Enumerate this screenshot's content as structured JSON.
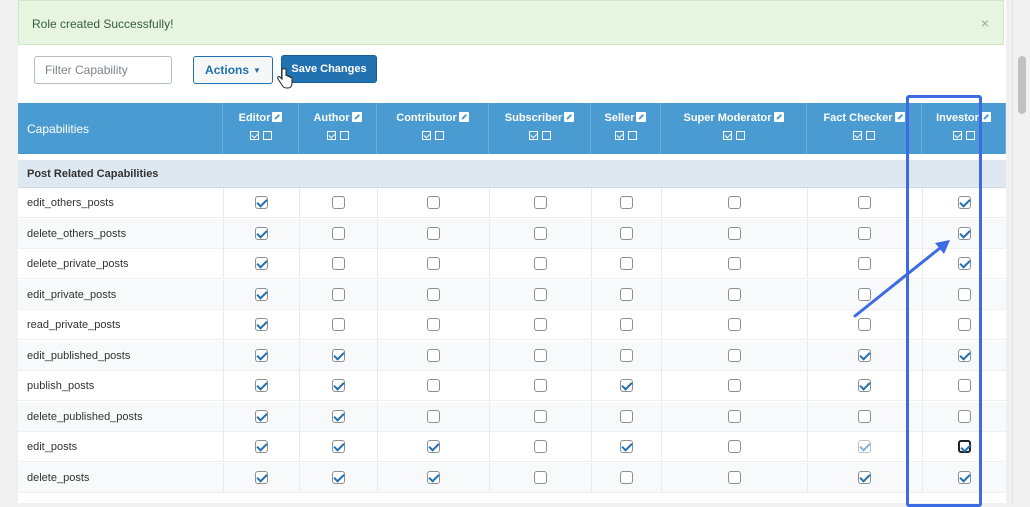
{
  "notice": {
    "message": "Role created Successfully!",
    "close_glyph": "×"
  },
  "toolbar": {
    "filter_placeholder": "Filter Capability",
    "actions_label": "Actions",
    "save_label": "Save Changes"
  },
  "table": {
    "first_header": "Capabilities",
    "roles": [
      "Editor",
      "Author",
      "Contributor",
      "Subscriber",
      "Seller",
      "Super Moderator",
      "Fact Checker",
      "Investor"
    ],
    "section": "Post Related Capabilities",
    "rows": [
      {
        "name": "edit_others_posts",
        "checks": [
          true,
          false,
          false,
          false,
          false,
          false,
          false,
          true
        ]
      },
      {
        "name": "delete_others_posts",
        "checks": [
          true,
          false,
          false,
          false,
          false,
          false,
          false,
          true
        ]
      },
      {
        "name": "delete_private_posts",
        "checks": [
          true,
          false,
          false,
          false,
          false,
          false,
          false,
          true
        ]
      },
      {
        "name": "edit_private_posts",
        "checks": [
          true,
          false,
          false,
          false,
          false,
          false,
          false,
          false
        ]
      },
      {
        "name": "read_private_posts",
        "checks": [
          true,
          false,
          false,
          false,
          false,
          false,
          false,
          false
        ]
      },
      {
        "name": "edit_published_posts",
        "checks": [
          true,
          true,
          false,
          false,
          false,
          false,
          true,
          true
        ]
      },
      {
        "name": "publish_posts",
        "checks": [
          true,
          true,
          false,
          false,
          true,
          false,
          true,
          false
        ]
      },
      {
        "name": "delete_published_posts",
        "checks": [
          true,
          true,
          false,
          false,
          false,
          false,
          false,
          false
        ]
      },
      {
        "name": "edit_posts",
        "checks": [
          true,
          true,
          true,
          false,
          true,
          false,
          true,
          true
        ]
      },
      {
        "name": "delete_posts",
        "checks": [
          true,
          true,
          true,
          false,
          false,
          false,
          true,
          true
        ]
      }
    ]
  },
  "colors": {
    "header_bg": "#4a9bd1",
    "section_bg": "#dde8f1",
    "notice_bg": "#e5f5df",
    "primary": "#2271b1",
    "highlight": "#3d6be4"
  }
}
